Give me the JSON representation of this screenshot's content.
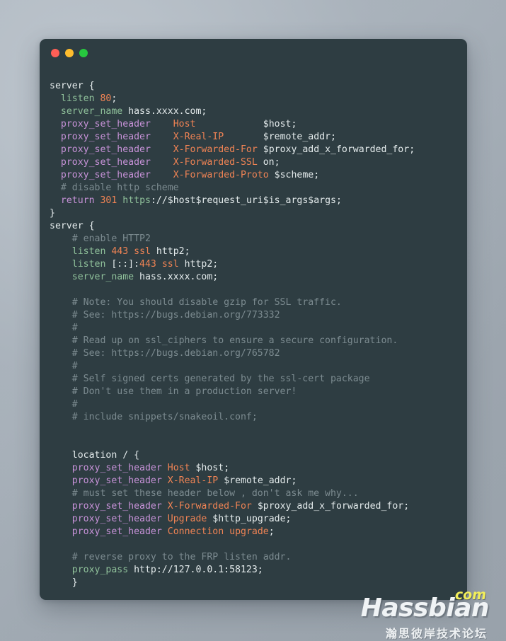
{
  "window": {
    "traffic_lights": [
      {
        "name": "close",
        "color": "#ff5f56"
      },
      {
        "name": "minimize",
        "color": "#ffbd2e"
      },
      {
        "name": "maximize",
        "color": "#27c93f"
      }
    ],
    "background_color": "#2e3d42"
  },
  "theme": {
    "desktop_background": "#aab3bc",
    "default_text": "#e4ebec",
    "directive": "#8fc09a",
    "keyword": "#c792d8",
    "literal": "#ef8354",
    "comment": "#7c8b90"
  },
  "code": {
    "language": "nginx",
    "lines": [
      {
        "n": 1,
        "text": "server {"
      },
      {
        "n": 2,
        "text": "  listen 80;"
      },
      {
        "n": 3,
        "text": "  server_name hass.xxxx.com;"
      },
      {
        "n": 4,
        "text": "  proxy_set_header    Host            $host;"
      },
      {
        "n": 5,
        "text": "  proxy_set_header    X-Real-IP       $remote_addr;"
      },
      {
        "n": 6,
        "text": "  proxy_set_header    X-Forwarded-For $proxy_add_x_forwarded_for;"
      },
      {
        "n": 7,
        "text": "  proxy_set_header    X-Forwarded-SSL on;"
      },
      {
        "n": 8,
        "text": "  proxy_set_header    X-Forwarded-Proto $scheme;"
      },
      {
        "n": 9,
        "text": "  # disable http scheme"
      },
      {
        "n": 10,
        "text": "  return 301 https://$host$request_uri$is_args$args;"
      },
      {
        "n": 11,
        "text": "}"
      },
      {
        "n": 12,
        "text": "server {"
      },
      {
        "n": 13,
        "text": "    # enable HTTP2"
      },
      {
        "n": 14,
        "text": "    listen 443 ssl http2;"
      },
      {
        "n": 15,
        "text": "    listen [::]:443 ssl http2;"
      },
      {
        "n": 16,
        "text": "    server_name hass.xxxx.com;"
      },
      {
        "n": 17,
        "text": ""
      },
      {
        "n": 18,
        "text": "    # Note: You should disable gzip for SSL traffic."
      },
      {
        "n": 19,
        "text": "    # See: https://bugs.debian.org/773332"
      },
      {
        "n": 20,
        "text": "    #"
      },
      {
        "n": 21,
        "text": "    # Read up on ssl_ciphers to ensure a secure configuration."
      },
      {
        "n": 22,
        "text": "    # See: https://bugs.debian.org/765782"
      },
      {
        "n": 23,
        "text": "    #"
      },
      {
        "n": 24,
        "text": "    # Self signed certs generated by the ssl-cert package"
      },
      {
        "n": 25,
        "text": "    # Don't use them in a production server!"
      },
      {
        "n": 26,
        "text": "    #"
      },
      {
        "n": 27,
        "text": "    # include snippets/snakeoil.conf;"
      },
      {
        "n": 28,
        "text": ""
      },
      {
        "n": 29,
        "text": ""
      },
      {
        "n": 30,
        "text": "    location / {"
      },
      {
        "n": 31,
        "text": "    proxy_set_header Host $host;"
      },
      {
        "n": 32,
        "text": "    proxy_set_header X-Real-IP $remote_addr;"
      },
      {
        "n": 33,
        "text": "    # must set these header below , don't ask me why..."
      },
      {
        "n": 34,
        "text": "    proxy_set_header X-Forwarded-For $proxy_add_x_forwarded_for;"
      },
      {
        "n": 35,
        "text": "    proxy_set_header Upgrade $http_upgrade;"
      },
      {
        "n": 36,
        "text": "    proxy_set_header Connection upgrade;"
      },
      {
        "n": 37,
        "text": ""
      },
      {
        "n": 38,
        "text": "    # reverse proxy to the FRP listen addr."
      },
      {
        "n": 39,
        "text": "    proxy_pass http://127.0.0.1:58123;"
      },
      {
        "n": 40,
        "text": "    }"
      }
    ]
  },
  "watermark": {
    "tld": "com",
    "brand": "Hassbian",
    "subtitle": "瀚思彼岸技术论坛",
    "tld_color": "#f2ee5a",
    "brand_color": "#f0f3f5"
  }
}
